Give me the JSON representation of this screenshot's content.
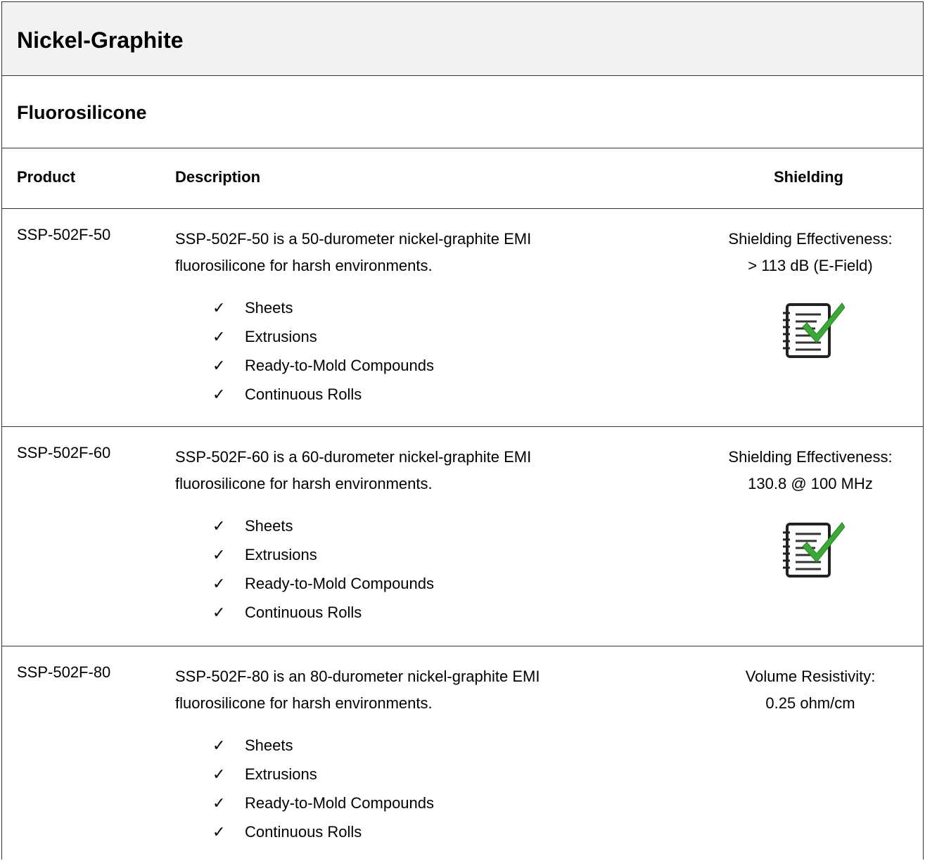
{
  "title": "Nickel-Graphite",
  "subtitle": "Fluorosilicone",
  "columns": {
    "product": "Product",
    "description": "Description",
    "shielding": "Shielding"
  },
  "rows": [
    {
      "product": "SSP-502F-50",
      "description": [
        "SSP-502F-50 is a 50-durometer nickel-graphite EMI",
        "fluorosilicone for harsh environments."
      ],
      "features": [
        "Sheets",
        "Extrusions",
        "Ready-to-Mold Compounds",
        "Continuous Rolls"
      ],
      "shielding": [
        "Shielding Effectiveness:",
        "> 113 dB (E-Field)"
      ],
      "icon": "datasheet-check-icon"
    },
    {
      "product": "SSP-502F-60",
      "description": [
        "SSP-502F-60 is a 60-durometer nickel-graphite EMI",
        "fluorosilicone for harsh environments."
      ],
      "features": [
        "Sheets",
        "Extrusions",
        "Ready-to-Mold Compounds",
        "Continuous Rolls"
      ],
      "shielding": [
        "Shielding Effectiveness:",
        "130.8 @ 100 MHz"
      ],
      "icon": "datasheet-check-icon"
    },
    {
      "product": "SSP-502F-80",
      "description": [
        "SSP-502F-80 is an 80-durometer nickel-graphite EMI",
        "fluorosilicone for harsh environments."
      ],
      "features": [
        "Sheets",
        "Extrusions",
        "Ready-to-Mold Compounds",
        "Continuous Rolls"
      ],
      "shielding": [
        "Volume Resistivity:",
        "0.25 ohm/cm"
      ]
    }
  ],
  "checkmark": "✓",
  "colors": {
    "header_bg": "#f2f2f2",
    "border": "#333333",
    "check_green": "#3aa935"
  }
}
